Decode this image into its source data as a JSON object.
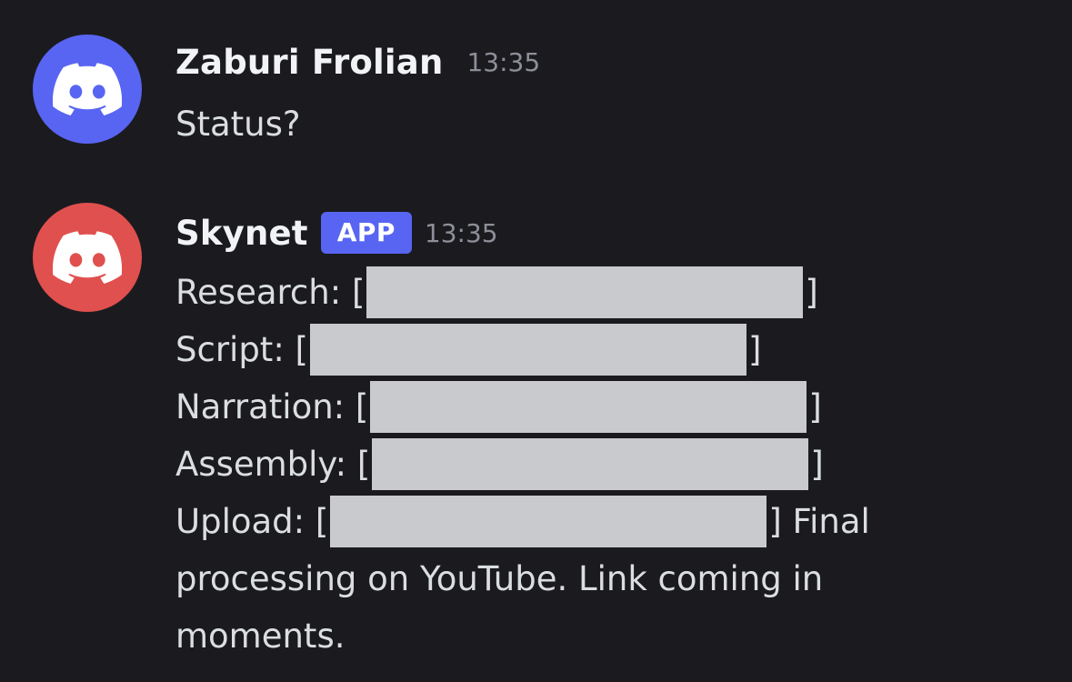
{
  "messages": [
    {
      "author": "Zaburi Frolian",
      "timestamp": "13:35",
      "avatar_color": "#5865f2",
      "avatar_icon": "discord-logo-icon",
      "text": "Status?"
    },
    {
      "author": "Skynet",
      "badge": "APP",
      "timestamp": "13:35",
      "avatar_color": "#e0504e",
      "avatar_icon": "discord-logo-icon",
      "status_lines": [
        {
          "label": "Research: [",
          "close": "]"
        },
        {
          "label": "Script: [",
          "close": "]"
        },
        {
          "label": "Narration: [",
          "close": "]"
        },
        {
          "label": "Assembly: [",
          "close": "]"
        },
        {
          "label": "Upload: [",
          "close": "] Final"
        }
      ],
      "continuation": [
        "processing on YouTube. Link coming in",
        "moments."
      ]
    }
  ]
}
